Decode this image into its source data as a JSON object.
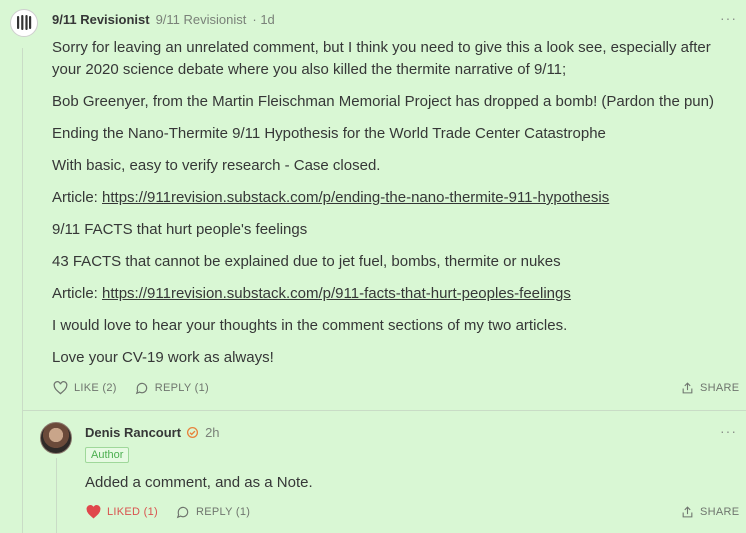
{
  "comment": {
    "author": "9/11 Revisionist",
    "handle": "9/11 Revisionist",
    "time": "1d",
    "more_icon": "ellipsis-icon",
    "paragraphs": [
      "Sorry for leaving an unrelated comment, but I think you need to give this a look see, especially after your 2020 science debate where you also killed the thermite narrative of 9/11;",
      "Bob Greenyer, from the Martin Fleischman Memorial Project has dropped a bomb! (Pardon the pun)",
      "Ending the Nano-Thermite 9/11 Hypothesis for the World Trade Center Catastrophe",
      "With basic, easy to verify research - Case closed."
    ],
    "article1_prefix": "Article: ",
    "article1_link": "https://911revision.substack.com/p/ending-the-nano-thermite-911-hypothesis",
    "paragraphs2": [
      "9/11 FACTS that hurt people's feelings",
      "43 FACTS that cannot be explained due to jet fuel, bombs, thermite or nukes"
    ],
    "article2_prefix": "Article: ",
    "article2_link": "https://911revision.substack.com/p/911-facts-that-hurt-peoples-feelings",
    "paragraphs3": [
      "I would love to hear your thoughts in the comment sections of my two articles.",
      "Love your CV-19 work as always!"
    ],
    "like_label": "LIKE (2)",
    "reply_label": "REPLY (1)",
    "share_label": "SHARE"
  },
  "reply": {
    "author": "Denis Rancourt",
    "time": "2h",
    "badge": "Author",
    "text": "Added a comment, and as a Note.",
    "like_label": "LIKED (1)",
    "reply_label": "REPLY (1)",
    "share_label": "SHARE",
    "liked_color": "#e0474c"
  }
}
